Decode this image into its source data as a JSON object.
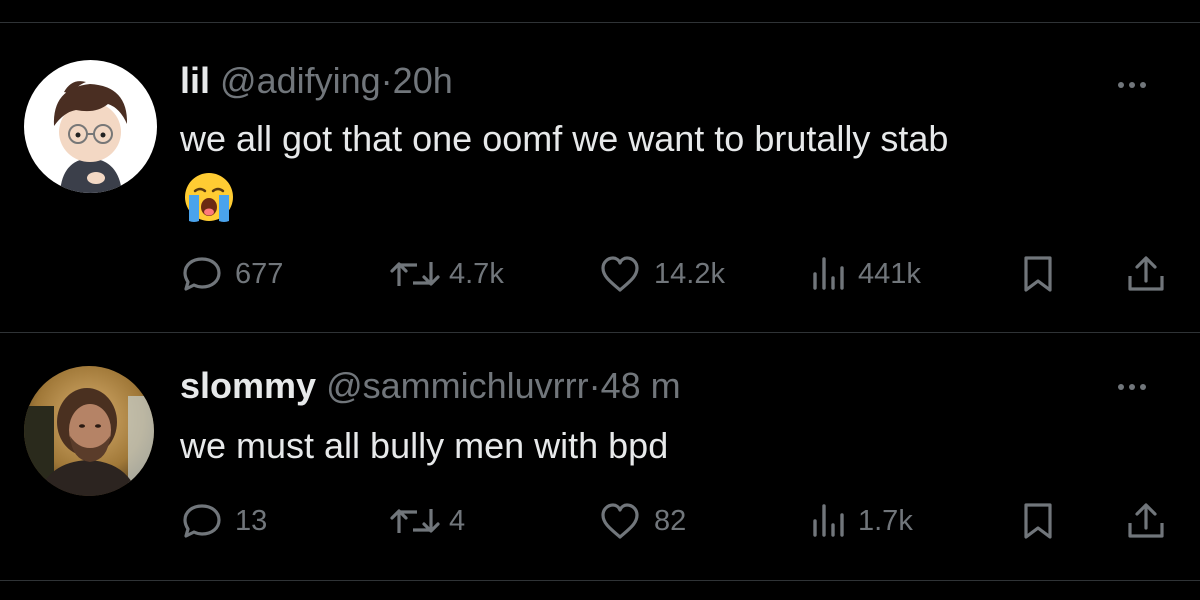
{
  "colors": {
    "background": "#000000",
    "primary_text": "#e7e9ea",
    "secondary_text": "#71767b",
    "divider": "#2f3336"
  },
  "tweets": [
    {
      "display_name": "lil",
      "handle": "@adifying",
      "separator": "·",
      "time": "20h",
      "text": "we all got that one oomf we want to brutally stab",
      "emoji": "loudly-crying-face",
      "stats": {
        "replies": "677",
        "reposts": "4.7k",
        "likes": "14.2k",
        "views": "441k"
      },
      "avatar": "cartoon-character-avatar"
    },
    {
      "display_name": "slommy",
      "handle": "@sammichluvrrr",
      "separator": "·",
      "time": "48 m",
      "text": "we must all bully men with bpd",
      "stats": {
        "replies": "13",
        "reposts": "4",
        "likes": "82",
        "views": "1.7k"
      },
      "avatar": "photo-avatar"
    }
  ]
}
